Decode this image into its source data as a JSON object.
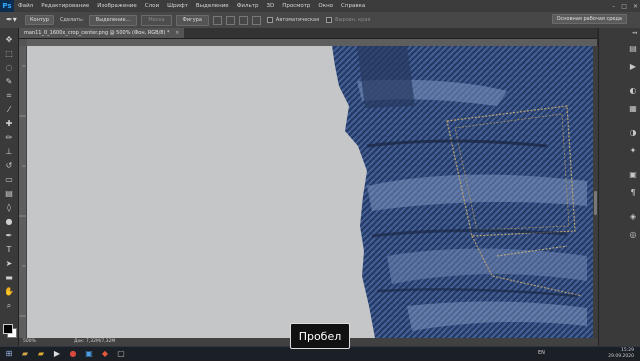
{
  "app": {
    "logo": "Ps"
  },
  "menu": [
    "Файл",
    "Редактирование",
    "Изображение",
    "Слои",
    "Шрифт",
    "Выделение",
    "Фильтр",
    "3D",
    "Просмотр",
    "Окно",
    "Справка"
  ],
  "options_bar": {
    "mode_select": "Контур",
    "make_label": "Сделать:",
    "selection_button": "Выделение...",
    "mask_button": "Маска",
    "shape_button": "Фигура",
    "autoalign_label": "Автоматическая",
    "align_edges_label": "Выровн. края",
    "workspace_select": "Основная рабочая среда"
  },
  "document": {
    "tab_title": "man11_0_1600x_crop_center.png @ 500% (Фон, RGB/8) *",
    "close_glyph": "×"
  },
  "status_bar": {
    "zoom": "500%",
    "doc_size": "Док: 7,32M/7,32M"
  },
  "taskbar": {
    "language": "EN",
    "time": "15:29",
    "date": "29.09.2020"
  },
  "overlay": {
    "key_hint": "Пробел"
  },
  "colors": {
    "canvas_bg": "#c5c6c8",
    "denim": "#2f4a7a",
    "accent": "#31a8ff"
  }
}
